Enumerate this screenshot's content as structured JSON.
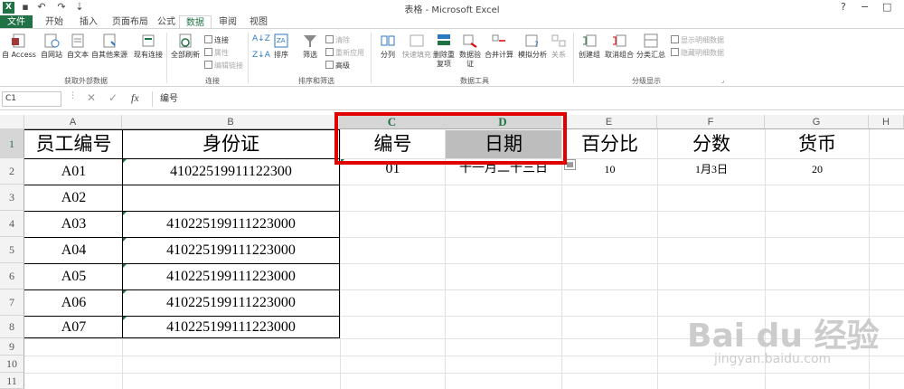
{
  "title_bar": {
    "title": "表格 - Microsoft Excel",
    "logo": "X",
    "help": "?",
    "minimize": "−",
    "restore": "□"
  },
  "tabs": [
    {
      "label": "文件"
    },
    {
      "label": "开始"
    },
    {
      "label": "插入"
    },
    {
      "label": "页面布局"
    },
    {
      "label": "公式"
    },
    {
      "label": "数据"
    },
    {
      "label": "审阅"
    },
    {
      "label": "视图"
    }
  ],
  "ribbon": {
    "get_external": {
      "label": "获取外部数据",
      "buttons": [
        "自 Access",
        "自网站",
        "自文本",
        "自其他来源",
        "现有连接"
      ]
    },
    "connections": {
      "label": "连接",
      "refresh": "全部刷新",
      "items": [
        "连接",
        "属性",
        "编辑链接"
      ]
    },
    "sort_filter": {
      "label": "排序和筛选",
      "sort": "排序",
      "filter": "筛选",
      "items": [
        "清除",
        "重新应用",
        "高级"
      ]
    },
    "data_tools": {
      "label": "数据工具",
      "buttons": [
        "分列",
        "快速填充",
        "删除重复项",
        "数据验证",
        "合并计算",
        "模拟分析",
        "关系"
      ]
    },
    "outline": {
      "label": "分级显示",
      "buttons": [
        "创建组",
        "取消组合",
        "分类汇总"
      ],
      "items": [
        "显示明细数据",
        "隐藏明细数据"
      ]
    }
  },
  "formula_bar": {
    "name_box": "C1",
    "cancel": "✕",
    "enter": "✓",
    "fx": "fx",
    "content": "编号"
  },
  "columns": [
    "A",
    "B",
    "C",
    "D",
    "E",
    "F",
    "G",
    "H"
  ],
  "rows": [
    "1",
    "2",
    "3",
    "4",
    "5",
    "6",
    "7",
    "8",
    "9",
    "10",
    "11"
  ],
  "cells": {
    "A1": "员工编号",
    "B1": "身份证",
    "C1": "编号",
    "D1": "日期",
    "E1": "百分比",
    "F1": "分数",
    "G1": "货币",
    "A2": "A01",
    "B2": "41022519911122300",
    "C2": "01",
    "D2": "十一月二十三日",
    "E2": "10",
    "F2": "1月3日",
    "G2": "20",
    "A3": "A02",
    "A4": "A03",
    "B4": "410225199111223000",
    "A5": "A04",
    "B5": "410225199111223000",
    "A6": "A05",
    "B6": "410225199111223000",
    "A7": "A06",
    "B7": "410225199111223000",
    "A8": "A07",
    "B8": "410225199111223000"
  },
  "watermark": {
    "brand": "Bai du 经验",
    "url": "jingyan.baidu.com"
  },
  "colors": {
    "excel_green": "#217346",
    "highlight_red": "#e00000",
    "selected_cell": "#bdbdbd"
  }
}
